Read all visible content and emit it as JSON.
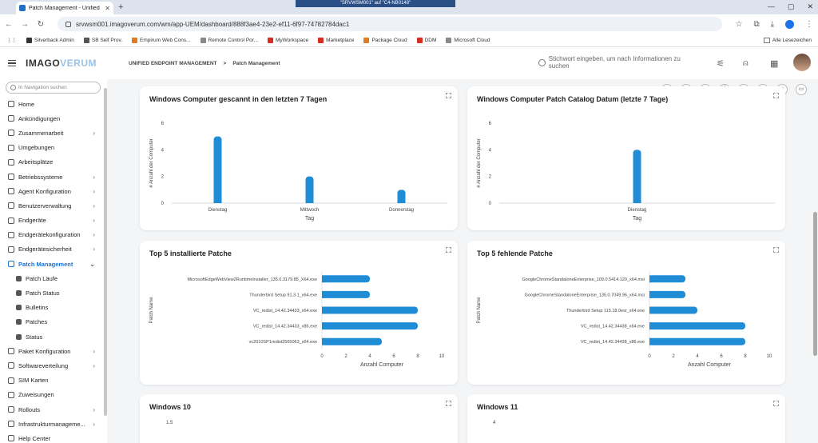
{
  "browser": {
    "tab_title": "Patch Management - Unified E",
    "remote_title": "\"SRVWSM001\" auf \"C4-NB0148\"",
    "url": "srvwsm001.imagoverum.com/wm/app-UEM/dashboard/888f3ae4-23e2-ef11-6f97-74782784dac1",
    "bookmarks": [
      {
        "label": "Silverback Admin",
        "color": "#333333"
      },
      {
        "label": "SB Self Prov.",
        "color": "#555555"
      },
      {
        "label": "Empirum Web Cons...",
        "color": "#e07b1f"
      },
      {
        "label": "Remote Control Por...",
        "color": "#888888"
      },
      {
        "label": "MyWorkspace",
        "color": "#d62d20"
      },
      {
        "label": "Marketplace",
        "color": "#d62d20"
      },
      {
        "label": "Package Cloud",
        "color": "#e07b1f"
      },
      {
        "label": "DDM",
        "color": "#d62d20"
      },
      {
        "label": "Microsoft Cloud",
        "color": "#888888"
      }
    ],
    "all_bookmarks": "Alle Lesezeichen"
  },
  "header": {
    "logo_main": "IMAGO",
    "logo_accent": "VERUM",
    "crumb_root": "UNIFIED ENDPOINT MANAGEMENT",
    "crumb_sep": ">",
    "crumb_current": "Patch Management",
    "search_placeholder": "Stichwort eingeben, um nach Informationen zu suchen"
  },
  "sidebar": {
    "search_placeholder": "In Navigation suchen",
    "items": [
      {
        "label": "Home",
        "chev": false,
        "icon": "home-icon"
      },
      {
        "label": "Ankündigungen",
        "chev": false,
        "icon": "megaphone-icon"
      },
      {
        "label": "Zusammenarbeit",
        "chev": true,
        "icon": "people-icon"
      },
      {
        "label": "Umgebungen",
        "chev": false,
        "icon": "globe-icon"
      },
      {
        "label": "Arbeitsplätze",
        "chev": false,
        "icon": "workstation-icon"
      },
      {
        "label": "Betriebssysteme",
        "chev": true,
        "icon": "os-icon"
      },
      {
        "label": "Agent Konfiguration",
        "chev": true,
        "icon": "gear-icon"
      },
      {
        "label": "Benutzerverwaltung",
        "chev": true,
        "icon": "users-icon"
      },
      {
        "label": "Endgeräte",
        "chev": true,
        "icon": "device-icon"
      },
      {
        "label": "Endgerätekonfiguration",
        "chev": true,
        "icon": "wrench-icon"
      },
      {
        "label": "Endgerätesicherheit",
        "chev": true,
        "icon": "lock-icon"
      },
      {
        "label": "Patch Management",
        "chev": true,
        "icon": "patch-icon",
        "active": true
      },
      {
        "label": "Patch Läufe",
        "sub": true,
        "icon": "grid-icon"
      },
      {
        "label": "Patch Status",
        "sub": true,
        "icon": "grid-icon"
      },
      {
        "label": "Bulletins",
        "sub": true,
        "icon": "grid-icon"
      },
      {
        "label": "Patches",
        "sub": true,
        "icon": "grid-icon"
      },
      {
        "label": "Status",
        "sub": true,
        "icon": "grid-icon"
      },
      {
        "label": "Paket Konfiguration",
        "chev": true,
        "icon": "package-icon"
      },
      {
        "label": "Softwareverteilung",
        "chev": true,
        "icon": "software-icon"
      },
      {
        "label": "SIM Karten",
        "chev": false,
        "icon": "sim-icon"
      },
      {
        "label": "Zuweisungen",
        "chev": false,
        "icon": "assign-icon"
      },
      {
        "label": "Rollouts",
        "chev": true,
        "icon": "rollout-icon"
      },
      {
        "label": "Infrastrukturmanageme...",
        "chev": true,
        "icon": "infra-icon"
      },
      {
        "label": "Help Center",
        "chev": false,
        "icon": "help-icon"
      }
    ]
  },
  "chart_data": [
    {
      "type": "bar",
      "title": "Windows Computer gescannt in den letzten 7 Tagen",
      "categories": [
        "Dienstag",
        "Mittwoch",
        "Donnerstag"
      ],
      "values": [
        5,
        2,
        1
      ],
      "xlabel": "Tag",
      "ylabel": "# Anzahl der Computer",
      "ylim": [
        0,
        6
      ],
      "yticks": [
        "0",
        "2",
        "4",
        "6"
      ],
      "color": "#1f8dd6"
    },
    {
      "type": "bar",
      "title": "Windows Computer Patch Catalog Datum (letzte 7 Tage)",
      "categories": [
        "Dienstag"
      ],
      "values": [
        4
      ],
      "xlabel": "Tag",
      "ylabel": "# Anzahl der Computer",
      "ylim": [
        0,
        6
      ],
      "yticks": [
        "0",
        "2",
        "4",
        "6"
      ],
      "color": "#1f8dd6"
    },
    {
      "type": "bar",
      "orientation": "horizontal",
      "title": "Top 5 installierte Patche",
      "categories": [
        "MicrosoftEdgeWebView2RuntimeInstaller_135.0.3179.85_X64.exe",
        "Thunderbird Setup 91.3.1_x64.exe",
        "VC_redist_14.42.34433_x64.exe",
        "VC_redist_14.42.34433_x86.exe",
        "vc2010SP1redist2565063_x64.exe"
      ],
      "values": [
        4,
        4,
        8,
        8,
        5
      ],
      "xlabel": "Anzahl Computer",
      "ylabel": "Patch Name",
      "xlim": [
        0,
        10
      ],
      "xticks": [
        "0",
        "2",
        "4",
        "6",
        "8",
        "10"
      ],
      "color": "#1f8dd6"
    },
    {
      "type": "bar",
      "orientation": "horizontal",
      "title": "Top 5 fehlende Patche",
      "categories": [
        "GoogleChromeStandaloneEnterprise_109.0.5414.120_x64.msi",
        "GoogleChromeStandaloneEnterprise_135.0.7049.96_x64.msi",
        "Thunderbird Setup 115.18.0esr_x64.exe",
        "VC_redist_14.42.34438_x64.exe",
        "VC_redist_14.42.34438_x86.exe"
      ],
      "values": [
        3,
        3,
        4,
        8,
        8
      ],
      "xlabel": "Anzahl Computer",
      "ylabel": "Patch Name",
      "xlim": [
        0,
        10
      ],
      "xticks": [
        "0",
        "2",
        "4",
        "6",
        "8",
        "10"
      ],
      "color": "#1f8dd6"
    }
  ],
  "bottom_cards": [
    {
      "title": "Windows 10",
      "first_tick": "1.5"
    },
    {
      "title": "Windows 11",
      "first_tick": "4"
    }
  ]
}
